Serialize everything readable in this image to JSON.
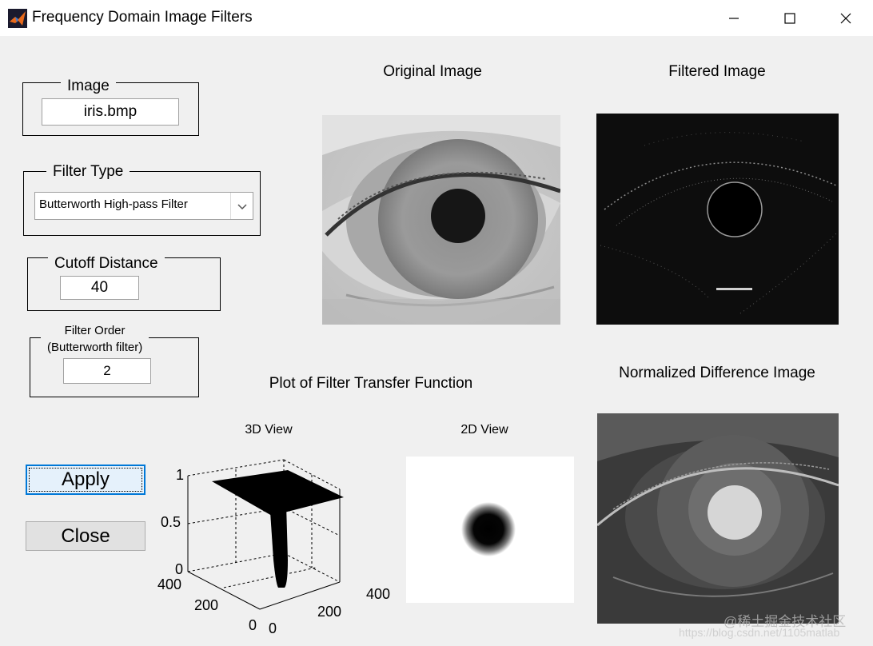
{
  "window": {
    "title": "Frequency Domain Image Filters",
    "controls": [
      "minimize-icon",
      "maximize-icon",
      "close-icon"
    ]
  },
  "image_panel": {
    "legend": "Image",
    "filename": "iris.bmp"
  },
  "filter_type_panel": {
    "legend": "Filter Type",
    "selected": "Butterworth High-pass Filter"
  },
  "cutoff_panel": {
    "legend": "Cutoff Distance",
    "value": "40"
  },
  "order_panel": {
    "legend_line1": "Filter Order",
    "legend_line2": "(Butterworth filter)",
    "value": "2"
  },
  "buttons": {
    "apply": "Apply",
    "close": "Close"
  },
  "axes": {
    "original": "Original Image",
    "filtered": "Filtered Image",
    "plot_heading": "Plot of Filter Transfer Function",
    "view3d": "3D View",
    "view2d": "2D View",
    "difference": "Normalized Difference Image"
  },
  "plot3d": {
    "z_ticks": [
      "1",
      "0.5",
      "0"
    ],
    "y_ticks": [
      "400",
      "200",
      "0"
    ],
    "x_ticks": [
      "0",
      "200",
      "400"
    ]
  },
  "watermark": {
    "line1": "@稀土掘金技术社区",
    "line2": "https://blog.csdn.net/1105matlab"
  }
}
